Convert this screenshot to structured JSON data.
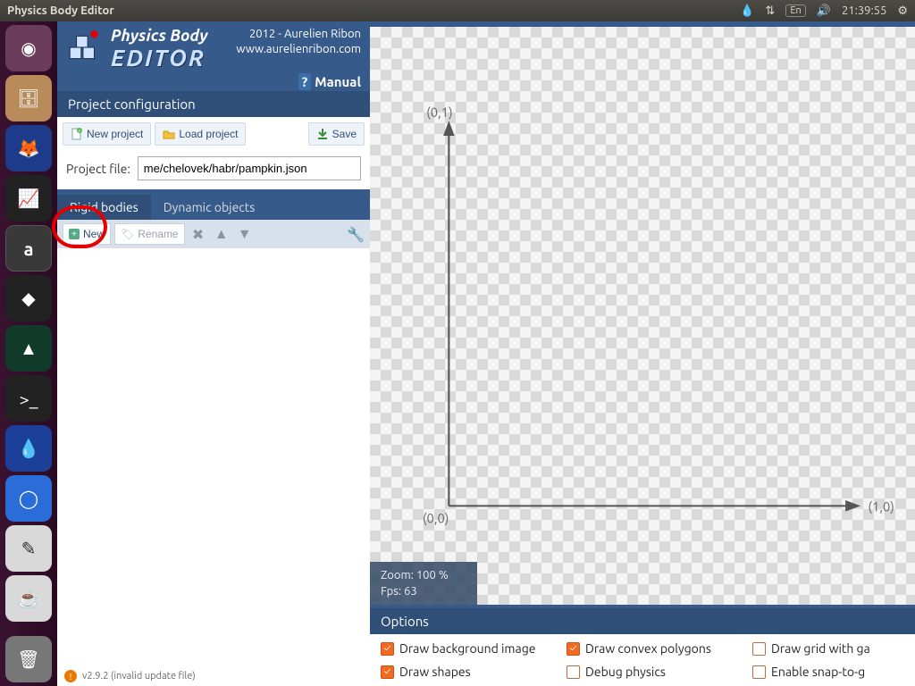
{
  "menubar": {
    "title": "Physics Body Editor",
    "lang": "En",
    "time": "21:39:55"
  },
  "launcher": {
    "items": [
      "dash",
      "files",
      "firefox",
      "monitor",
      "a-app",
      "inkscape",
      "android",
      "terminal",
      "water",
      "chromium",
      "editor",
      "java"
    ],
    "trash": "trash"
  },
  "header": {
    "title_top": "Physics Body",
    "title_bottom": "EDITOR",
    "credit1": "2012 - Aurelien Ribon",
    "credit2": "www.aurelienribon.com",
    "manual": "Manual"
  },
  "projectConfig": {
    "title": "Project configuration",
    "new": "New project",
    "load": "Load project",
    "save": "Save",
    "file_label": "Project file:",
    "file_value": "me/chelovek/habr/pampkin.json"
  },
  "tabs": {
    "rigid": "Rigid bodies",
    "dynamic": "Dynamic objects"
  },
  "rbToolbar": {
    "new": "New",
    "rename": "Rename"
  },
  "status": {
    "version": "v2.9.2 (invalid update file)"
  },
  "canvas": {
    "lbl01": "(0,1)",
    "lbl00": "(0,0)",
    "lbl10": "(1,0)",
    "zoom": "Zoom: 100 %",
    "fps": "Fps: 63"
  },
  "options": {
    "title": "Options",
    "items": [
      {
        "label": "Draw background image",
        "checked": true
      },
      {
        "label": "Draw convex polygons",
        "checked": true
      },
      {
        "label": "Draw grid with ga",
        "checked": false
      },
      {
        "label": "Draw shapes",
        "checked": true
      },
      {
        "label": "Debug physics",
        "checked": false
      },
      {
        "label": "Enable snap-to-g",
        "checked": false
      }
    ]
  }
}
